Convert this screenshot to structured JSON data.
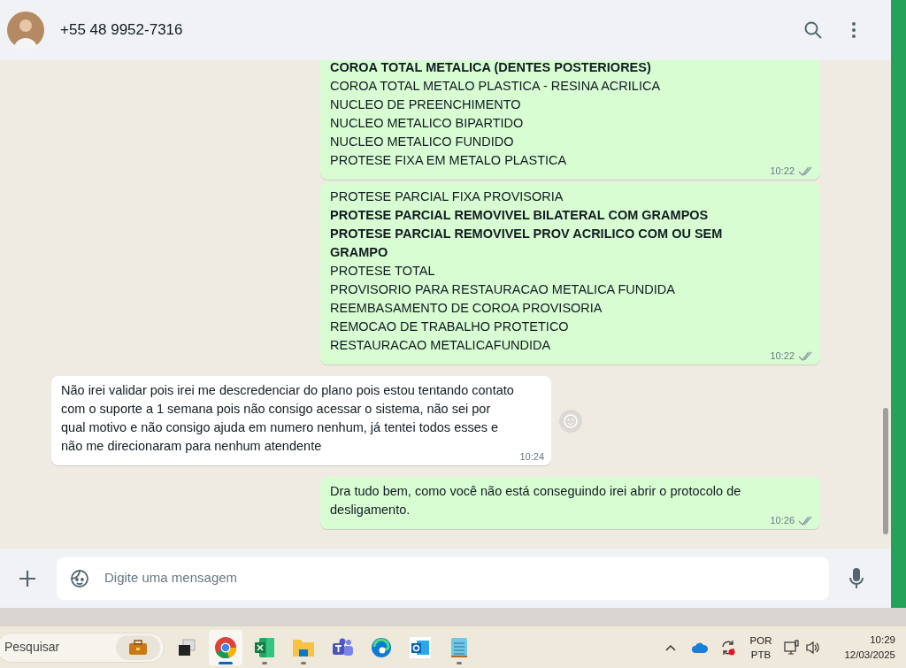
{
  "header": {
    "contact": "+55 48 9952-7316"
  },
  "messages": [
    {
      "kind": "outgoing",
      "time": "10:22",
      "lines": [
        {
          "text": "COROA TOTAL METALICA (DENTES POSTERIORES)",
          "bold": true
        },
        {
          "text": "COROA TOTAL METALO PLASTICA - RESINA ACRILICA",
          "bold": false
        },
        {
          "text": "NUCLEO DE PREENCHIMENTO",
          "bold": false
        },
        {
          "text": "NUCLEO METALICO BIPARTIDO",
          "bold": false
        },
        {
          "text": "NUCLEO METALICO FUNDIDO",
          "bold": false
        },
        {
          "text": "PROTESE FIXA EM METALO PLASTICA",
          "bold": false
        }
      ]
    },
    {
      "kind": "outgoing",
      "time": "10:22",
      "lines": [
        {
          "text": "PROTESE PARCIAL FIXA PROVISORIA",
          "bold": false
        },
        {
          "text": "PROTESE PARCIAL REMOVIVEL BILATERAL COM GRAMPOS",
          "bold": true
        },
        {
          "text": "PROTESE PARCIAL REMOVIVEL PROV ACRILICO COM OU SEM GRAMPO",
          "bold": true
        },
        {
          "text": "PROTESE TOTAL",
          "bold": false
        },
        {
          "text": "PROVISORIO PARA RESTAURACAO METALICA FUNDIDA",
          "bold": false
        },
        {
          "text": "REEMBASAMENTO DE COROA PROVISORIA",
          "bold": false
        },
        {
          "text": "REMOCAO DE TRABALHO PROTETICO",
          "bold": false
        },
        {
          "text": "RESTAURACAO METALICAFUNDIDA",
          "bold": false
        }
      ]
    },
    {
      "kind": "incoming",
      "time": "10:24",
      "lines": [
        {
          "text": "Não irei validar pois irei me descredenciar do plano pois estou tentando contato com o suporte a 1 semana pois não consigo acessar o sistema, não sei por qual motivo e não consigo ajuda em numero nenhum, já tentei todos esses e não me direcionaram para nenhum atendente",
          "bold": false
        }
      ]
    },
    {
      "kind": "outgoing",
      "time": "10:26",
      "lines": [
        {
          "text": "Dra tudo bem, como você não está conseguindo irei abrir o protocolo de desligamento.",
          "bold": false
        }
      ]
    }
  ],
  "composer": {
    "placeholder": "Digite uma mensagem"
  },
  "taskbar": {
    "search_placeholder": "Pesquisar",
    "apps": [
      {
        "kind": "taskview",
        "running": false,
        "selected": false
      },
      {
        "kind": "chrome",
        "running": true,
        "selected": true
      },
      {
        "kind": "excel",
        "running": true,
        "selected": false
      },
      {
        "kind": "files",
        "running": true,
        "selected": false
      },
      {
        "kind": "teams",
        "running": false,
        "selected": false
      },
      {
        "kind": "edge",
        "running": false,
        "selected": false
      },
      {
        "kind": "outlook",
        "running": false,
        "selected": false
      },
      {
        "kind": "notepad",
        "running": true,
        "selected": false
      }
    ],
    "language": [
      "POR",
      "PTB"
    ],
    "time": "10:29",
    "date": "12/03/2025"
  }
}
